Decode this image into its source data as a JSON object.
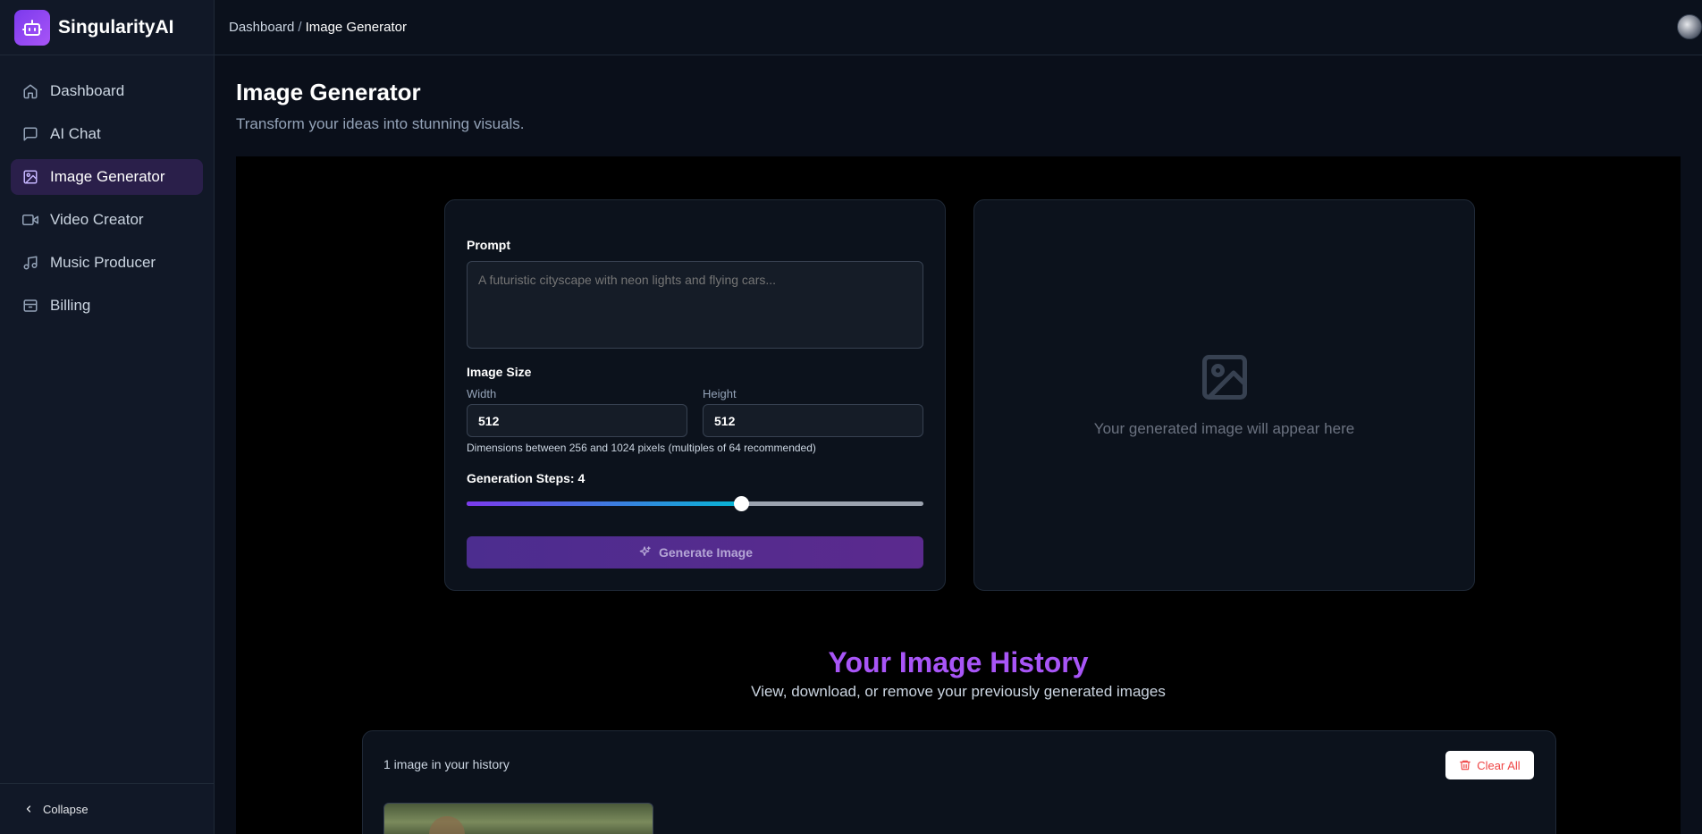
{
  "app": {
    "name": "SingularityAI"
  },
  "sidebar": {
    "items": [
      {
        "label": "Dashboard",
        "icon": "home-icon",
        "active": false
      },
      {
        "label": "AI Chat",
        "icon": "chat-icon",
        "active": false
      },
      {
        "label": "Image Generator",
        "icon": "image-icon",
        "active": true
      },
      {
        "label": "Video Creator",
        "icon": "video-icon",
        "active": false
      },
      {
        "label": "Music Producer",
        "icon": "music-icon",
        "active": false
      },
      {
        "label": "Billing",
        "icon": "billing-icon",
        "active": false
      }
    ],
    "collapse_label": "Collapse"
  },
  "header": {
    "breadcrumb": {
      "parent": "Dashboard",
      "separator": "/",
      "current": "Image Generator"
    }
  },
  "page": {
    "title": "Image Generator",
    "subtitle": "Transform your ideas into stunning visuals."
  },
  "form": {
    "prompt_label": "Prompt",
    "prompt_placeholder": "A futuristic cityscape with neon lights and flying cars...",
    "prompt_value": "",
    "size_label": "Image Size",
    "width_label": "Width",
    "width_value": "512",
    "height_label": "Height",
    "height_value": "512",
    "size_hint": "Dimensions between 256 and 1024 pixels (multiples of 64 recommended)",
    "steps_label": "Generation Steps: 4",
    "steps_fraction": 0.6,
    "generate_label": "Generate Image"
  },
  "preview": {
    "placeholder_text": "Your generated image will appear here"
  },
  "history": {
    "title": "Your Image History",
    "subtitle": "View, download, or remove your previously generated images",
    "count_text": "1 image in your history",
    "clear_label": "Clear All"
  },
  "colors": {
    "accent": "#a855f7",
    "active_nav_bg": "#2a1f4a",
    "danger": "#ef4444"
  }
}
